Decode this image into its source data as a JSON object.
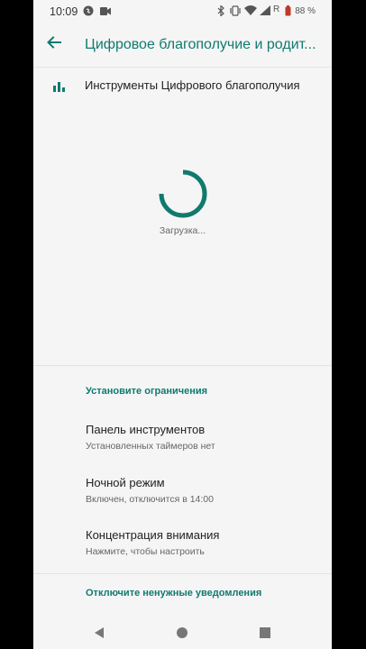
{
  "status_bar": {
    "time": "10:09",
    "battery_percent": "88 %",
    "icons": [
      "shazam-icon",
      "video-icon",
      "bluetooth-icon",
      "vibrate-icon",
      "wifi-icon",
      "signal-icon",
      "battery-icon"
    ]
  },
  "app_bar": {
    "title": "Цифровое благополучие и родит...",
    "back_icon": "arrow-back-icon"
  },
  "tools_row": {
    "label": "Инструменты Цифрового благополучия",
    "icon": "bar-chart-icon"
  },
  "loading": {
    "text": "Загрузка..."
  },
  "sections": {
    "limits_header": "Установите ограничения",
    "notifications_header": "Отключите ненужные уведомления"
  },
  "items": [
    {
      "title": "Панель инструментов",
      "subtitle": "Установленных таймеров нет"
    },
    {
      "title": "Ночной режим",
      "subtitle": "Включен, отключится в 14:00"
    },
    {
      "title": "Концентрация внимания",
      "subtitle": "Нажмите, чтобы настроить"
    }
  ],
  "colors": {
    "accent": "#107a6f",
    "background": "#f5f5f5"
  }
}
